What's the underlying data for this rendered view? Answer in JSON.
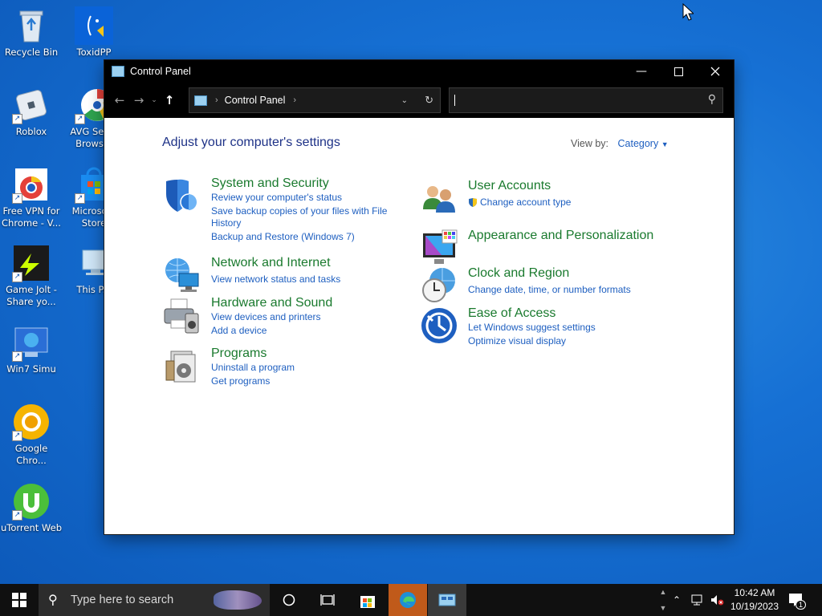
{
  "desktop": {
    "icons": [
      {
        "label": "Recycle Bin"
      },
      {
        "label": "ToxidPP"
      },
      {
        "label": "Roblox"
      },
      {
        "label": "AVG Sec... Brows..."
      },
      {
        "label": "Free VPN for Chrome - V..."
      },
      {
        "label": "Microso... Store"
      },
      {
        "label": "Game Jolt - Share yo..."
      },
      {
        "label": "This P..."
      },
      {
        "label": "Win7 Simu"
      },
      {
        "label": "Google Chro..."
      },
      {
        "label": "uTorrent Web"
      }
    ]
  },
  "window": {
    "title": "Control Panel",
    "breadcrumb": "Control Panel",
    "search_placeholder": "",
    "heading": "Adjust your computer's settings",
    "view_by_label": "View by:",
    "view_by_value": "Category",
    "categories": [
      {
        "title": "System and Security",
        "icon": "shield-icon",
        "links": [
          "Review your computer's status",
          "Save backup copies of your files with File",
          "History",
          "Backup and Restore (Windows 7)"
        ]
      },
      {
        "title": "Network and Internet",
        "icon": "network-icon",
        "links": [
          "View network status and tasks"
        ]
      },
      {
        "title": "Hardware and Sound",
        "icon": "printer-icon",
        "links": [
          "View devices and printers",
          "Add a device"
        ]
      },
      {
        "title": "Programs",
        "icon": "programs-icon",
        "links": [
          "Uninstall a program",
          "Get programs"
        ]
      },
      {
        "title": "User Accounts",
        "icon": "users-icon",
        "links": [
          "Change account type"
        ]
      },
      {
        "title": "Appearance and Personalization",
        "icon": "monitor-icon",
        "links": []
      },
      {
        "title": "Clock and Region",
        "icon": "clock-icon",
        "links": [
          "Change date, time, or number formats"
        ]
      },
      {
        "title": "Ease of Access",
        "icon": "ease-of-access-icon",
        "links": [
          "Let Windows suggest settings",
          "Optimize visual display"
        ]
      }
    ]
  },
  "taskbar": {
    "search_label": "Type here to search",
    "time": "10:42 AM",
    "date": "10/19/2023",
    "notification_count": "1"
  },
  "colors": {
    "link": "#1e5fc0",
    "category_title": "#1a7a2e",
    "heading": "#1e3287",
    "titlebar": "#000000"
  }
}
